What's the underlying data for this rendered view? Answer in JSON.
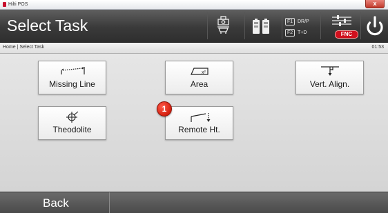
{
  "window": {
    "title": "Hilti POS",
    "close_glyph": "x"
  },
  "header": {
    "title": "Select Task",
    "icons": [
      "instrument-icon",
      "battery-icon"
    ],
    "f1": {
      "key": "F1",
      "label": "DR/P"
    },
    "f2": {
      "key": "F2",
      "label": "T+D"
    },
    "fnc_label": "FNC",
    "power_icon": "power-icon"
  },
  "breadcrumb": "Home | Select Task",
  "clock": "01:53",
  "tasks": [
    {
      "label": "Missing Line",
      "icon": "missing-line-icon"
    },
    {
      "label": "Area",
      "icon": "area-icon"
    },
    {
      "label": "Vert. Align.",
      "icon": "vertical-alignment-icon"
    },
    {
      "label": "Theodolite",
      "icon": "theodolite-icon"
    },
    {
      "label": "Remote Ht.",
      "icon": "remote-height-icon"
    }
  ],
  "badge": "1",
  "footer": {
    "back_label": "Back"
  },
  "colors": {
    "header": "#3a3a3a",
    "accent_red": "#d0101e",
    "badge": "#e0281a"
  }
}
